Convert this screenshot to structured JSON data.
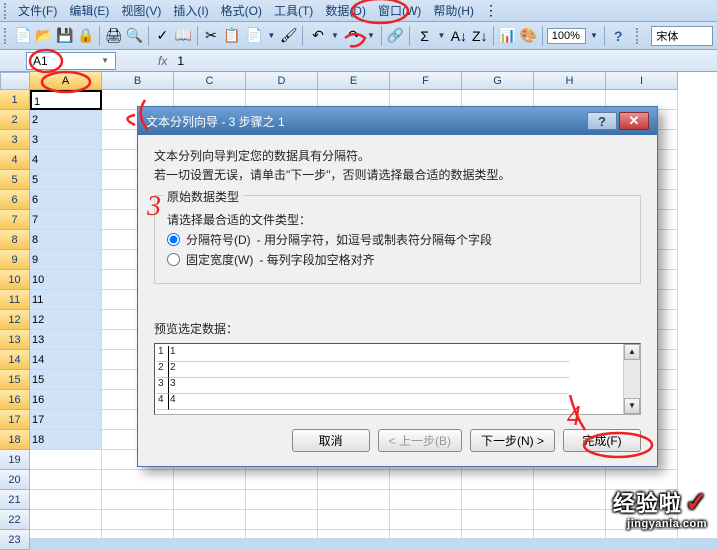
{
  "menubar": {
    "items": [
      {
        "label": "文件(F)"
      },
      {
        "label": "编辑(E)"
      },
      {
        "label": "视图(V)"
      },
      {
        "label": "插入(I)"
      },
      {
        "label": "格式(O)"
      },
      {
        "label": "工具(T)"
      },
      {
        "label": "数据(D)"
      },
      {
        "label": "窗口(W)"
      },
      {
        "label": "帮助(H)"
      }
    ]
  },
  "toolbar": {
    "zoom": "100%",
    "font": "宋体"
  },
  "name_box": "A1",
  "formula_value": "1",
  "columns": [
    "A",
    "B",
    "C",
    "D",
    "E",
    "F",
    "G",
    "H",
    "I"
  ],
  "rows": [
    {
      "num": "1",
      "a": "1"
    },
    {
      "num": "2",
      "a": "2"
    },
    {
      "num": "3",
      "a": "3"
    },
    {
      "num": "4",
      "a": "4"
    },
    {
      "num": "5",
      "a": "5"
    },
    {
      "num": "6",
      "a": "6"
    },
    {
      "num": "7",
      "a": "7"
    },
    {
      "num": "8",
      "a": "8"
    },
    {
      "num": "9",
      "a": "9"
    },
    {
      "num": "10",
      "a": "10"
    },
    {
      "num": "11",
      "a": "11"
    },
    {
      "num": "12",
      "a": "12"
    },
    {
      "num": "13",
      "a": "13"
    },
    {
      "num": "14",
      "a": "14"
    },
    {
      "num": "15",
      "a": "15"
    },
    {
      "num": "16",
      "a": "16"
    },
    {
      "num": "17",
      "a": "17"
    },
    {
      "num": "18",
      "a": "18"
    },
    {
      "num": "19",
      "a": ""
    },
    {
      "num": "20",
      "a": ""
    },
    {
      "num": "21",
      "a": ""
    },
    {
      "num": "22",
      "a": ""
    },
    {
      "num": "23",
      "a": ""
    }
  ],
  "dialog": {
    "title": "文本分列向导 - 3 步骤之 1",
    "msg1": "文本分列向导判定您的数据具有分隔符。",
    "msg2": "若一切设置无误，请单击\"下一步\"，否则请选择最合适的数据类型。",
    "fieldset_title": "原始数据类型",
    "fieldset_sub": "请选择最合适的文件类型：",
    "radio1_label": "分隔符号(D)",
    "radio1_desc": "- 用分隔字符，如逗号或制表符分隔每个字段",
    "radio2_label": "固定宽度(W)",
    "radio2_desc": "- 每列字段加空格对齐",
    "preview_label": "预览选定数据：",
    "preview_rows": [
      {
        "n": "1",
        "v": "1"
      },
      {
        "n": "2",
        "v": "2"
      },
      {
        "n": "3",
        "v": "3"
      },
      {
        "n": "4",
        "v": "4"
      }
    ],
    "btn_cancel": "取消",
    "btn_back": "< 上一步(B)",
    "btn_next": "下一步(N) >",
    "btn_finish": "完成(F)"
  },
  "annotations": {
    "num2": "2",
    "num3": "3",
    "num4": "4"
  },
  "watermark": {
    "big": "经验啦",
    "small": "jingyanla.com"
  }
}
